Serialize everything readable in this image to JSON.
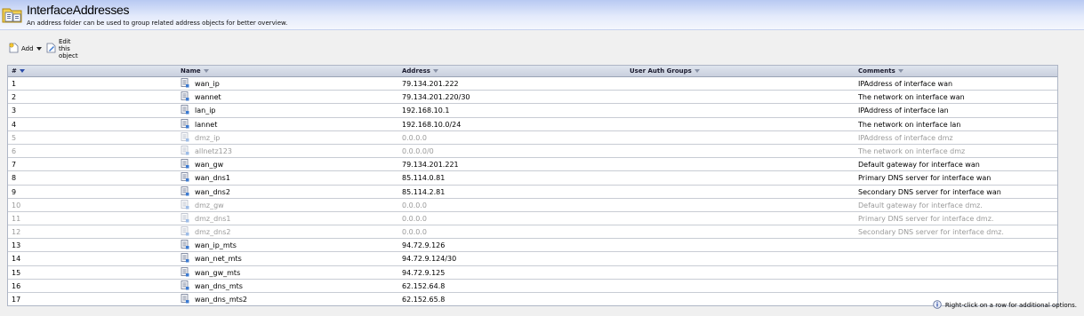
{
  "header": {
    "title": "InterfaceAddresses",
    "subtitle": "An address folder can be used to group related address objects for better overview."
  },
  "toolbar": {
    "add_label": "Add",
    "edit_label": "Edit this object"
  },
  "table": {
    "columns": [
      "#",
      "Name",
      "Address",
      "User Auth Groups",
      "Comments"
    ],
    "rows": [
      {
        "num": "1",
        "name": "wan_ip",
        "address": "79.134.201.222",
        "uag": "",
        "comment": "IPAddress of interface wan",
        "disabled": false
      },
      {
        "num": "2",
        "name": "wannet",
        "address": "79.134.201.220/30",
        "uag": "",
        "comment": "The network on interface wan",
        "disabled": false
      },
      {
        "num": "3",
        "name": "lan_ip",
        "address": "192.168.10.1",
        "uag": "",
        "comment": "IPAddress of interface lan",
        "disabled": false
      },
      {
        "num": "4",
        "name": "lannet",
        "address": "192.168.10.0/24",
        "uag": "",
        "comment": "The network on interface lan",
        "disabled": false
      },
      {
        "num": "5",
        "name": "dmz_ip",
        "address": "0.0.0.0",
        "uag": "",
        "comment": "IPAddress of interface dmz",
        "disabled": true
      },
      {
        "num": "6",
        "name": "allnetz123",
        "address": "0.0.0.0/0",
        "uag": "",
        "comment": "The network on interface dmz",
        "disabled": true
      },
      {
        "num": "7",
        "name": "wan_gw",
        "address": "79.134.201.221",
        "uag": "",
        "comment": "Default gateway for interface wan",
        "disabled": false
      },
      {
        "num": "8",
        "name": "wan_dns1",
        "address": "85.114.0.81",
        "uag": "",
        "comment": "Primary DNS server for interface wan",
        "disabled": false
      },
      {
        "num": "9",
        "name": "wan_dns2",
        "address": "85.114.2.81",
        "uag": "",
        "comment": "Secondary DNS server for interface wan",
        "disabled": false
      },
      {
        "num": "10",
        "name": "dmz_gw",
        "address": "0.0.0.0",
        "uag": "",
        "comment": "Default gateway for interface dmz.",
        "disabled": true
      },
      {
        "num": "11",
        "name": "dmz_dns1",
        "address": "0.0.0.0",
        "uag": "",
        "comment": "Primary DNS server for interface dmz.",
        "disabled": true
      },
      {
        "num": "12",
        "name": "dmz_dns2",
        "address": "0.0.0.0",
        "uag": "",
        "comment": "Secondary DNS server for interface dmz.",
        "disabled": true
      },
      {
        "num": "13",
        "name": "wan_ip_mts",
        "address": "94.72.9.126",
        "uag": "",
        "comment": "",
        "disabled": false
      },
      {
        "num": "14",
        "name": "wan_net_mts",
        "address": "94.72.9.124/30",
        "uag": "",
        "comment": "",
        "disabled": false
      },
      {
        "num": "15",
        "name": "wan_gw_mts",
        "address": "94.72.9.125",
        "uag": "",
        "comment": "",
        "disabled": false
      },
      {
        "num": "16",
        "name": "wan_dns_mts",
        "address": "62.152.64.8",
        "uag": "",
        "comment": "",
        "disabled": false
      },
      {
        "num": "17",
        "name": "wan_dns_mts2",
        "address": "62.152.65.8",
        "uag": "",
        "comment": "",
        "disabled": false
      }
    ]
  },
  "footer": {
    "hint": "Right-click on a row for additional options."
  },
  "colors": {
    "header_gradient_top": "#b8c9f2",
    "disabled_text": "#9a9a9a",
    "grid_border": "#aeb6c6"
  },
  "icons": {
    "folder": "address-folder-icon",
    "add": "add-document-icon",
    "edit": "edit-object-icon",
    "address": "ip-address-icon",
    "info": "info-icon"
  }
}
